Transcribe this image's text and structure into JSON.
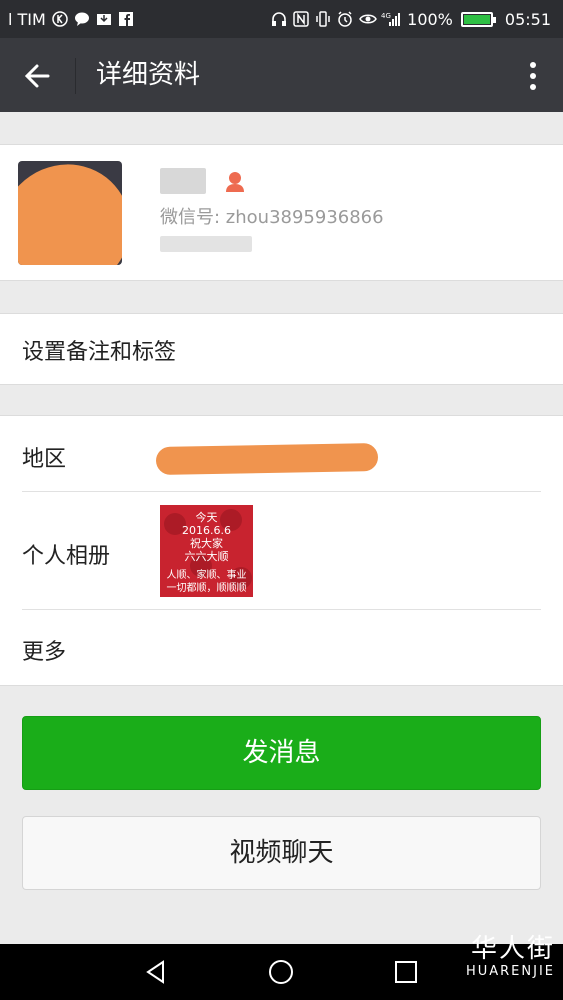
{
  "status_bar": {
    "left_text": "l TIM",
    "battery": "100%",
    "time": "05:51",
    "icons_left": [
      "k-circle-icon",
      "chat-bubble-icon",
      "mail-download-icon",
      "facebook-icon"
    ],
    "icons_right": [
      "headphones-icon",
      "nfc-icon",
      "vibrate-icon",
      "alarm-icon",
      "eye-icon",
      "signal-4g-icon"
    ],
    "battery_color": "#2fbf44"
  },
  "nav": {
    "title": "详细资料",
    "back_icon": "back-arrow-icon",
    "more_icon": "more-vertical-icon"
  },
  "profile": {
    "wechat_id": "微信号: zhou3895936866",
    "gender_icon": "female-icon"
  },
  "remark": {
    "label": "设置备注和标签"
  },
  "info": {
    "region_label": "地区",
    "album_label": "个人相册",
    "album_lines": [
      "今天",
      "2016.6.6",
      "祝大家",
      "六六大顺",
      "人顺、家顺、事业",
      "一切都顺，顺顺顺"
    ],
    "more_label": "更多"
  },
  "actions": {
    "send_message": "发消息",
    "video_chat": "视频聊天",
    "primary_color": "#1aad19"
  },
  "watermark": {
    "cn": "华人街",
    "en": "HUARENJIE"
  }
}
